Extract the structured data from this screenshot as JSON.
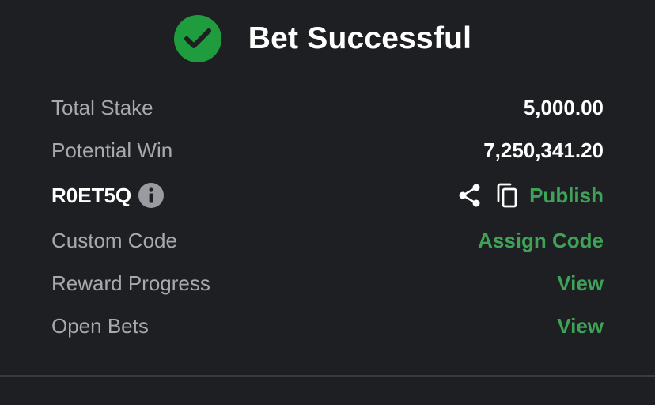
{
  "header": {
    "title": "Bet Successful",
    "icon": "check-circle-icon",
    "accent": "#1f9d3e"
  },
  "summary": {
    "total_stake_label": "Total Stake",
    "total_stake_value": "5,000.00",
    "potential_win_label": "Potential Win",
    "potential_win_value": "7,250,341.20",
    "booking_code": "R0ET5Q",
    "publish_label": "Publish",
    "custom_code_label": "Custom Code",
    "assign_code_label": "Assign Code",
    "reward_progress_label": "Reward Progress",
    "reward_view_label": "View",
    "open_bets_label": "Open Bets",
    "open_bets_view_label": "View"
  },
  "icons": {
    "info": "info-icon",
    "share": "share-icon",
    "copy": "copy-icon"
  },
  "colors": {
    "background": "#1e1f23",
    "link": "#3fa357",
    "label": "#a8a9ae"
  }
}
